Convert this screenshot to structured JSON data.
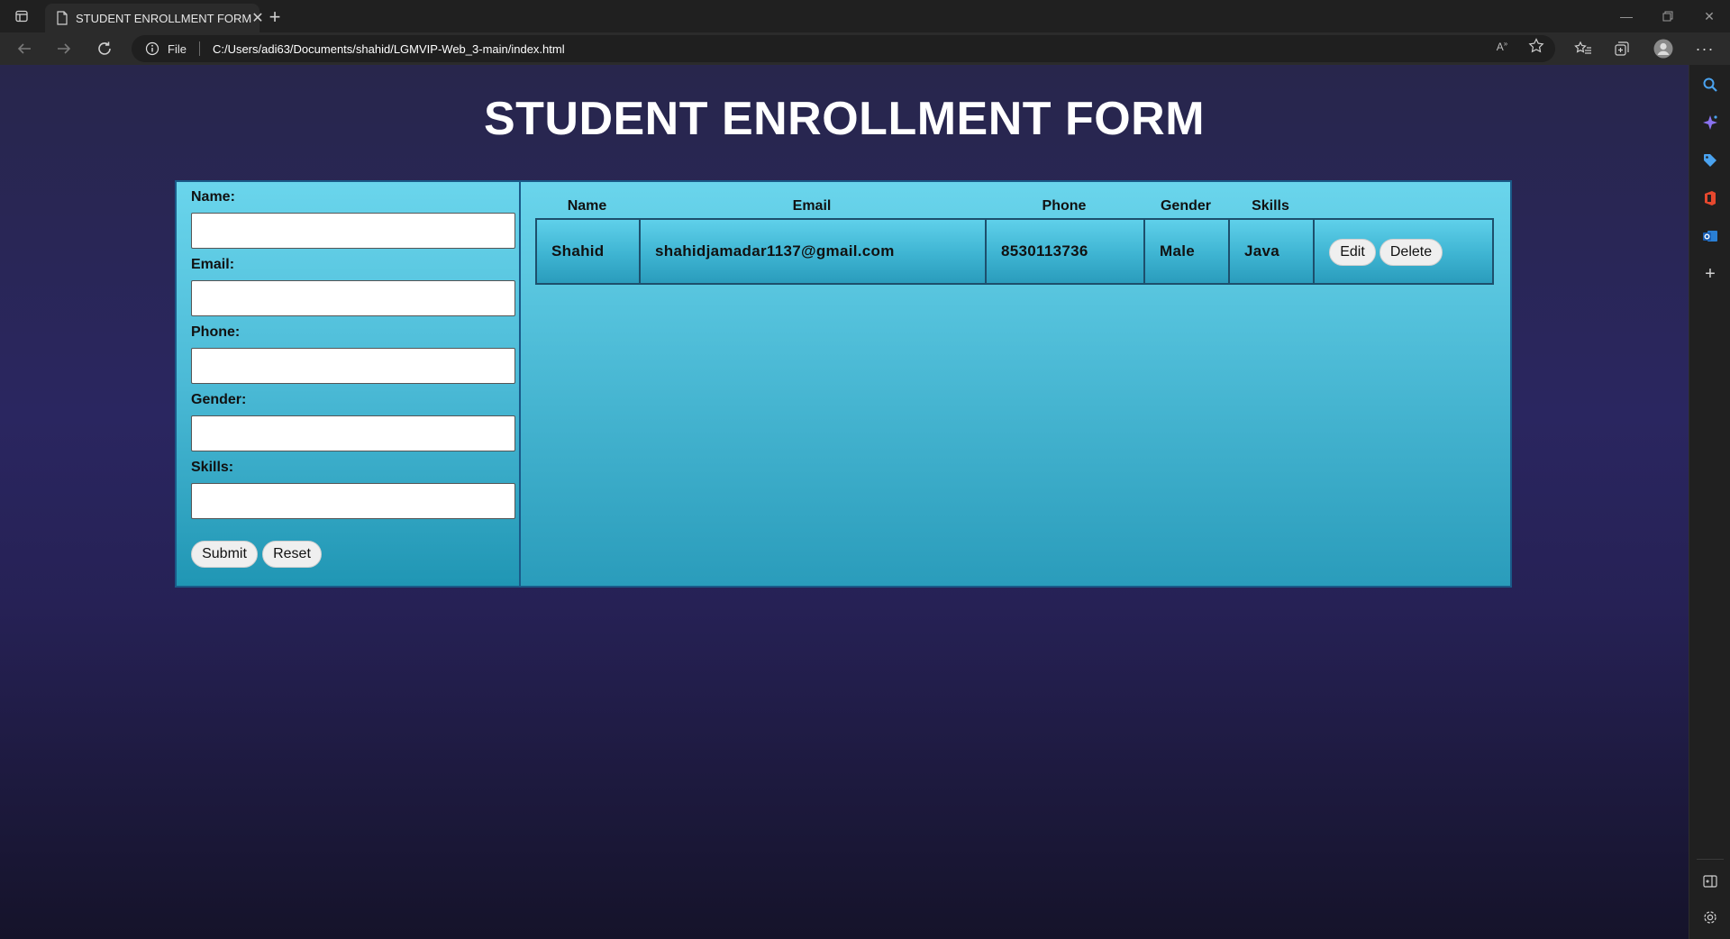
{
  "browser": {
    "tab_title": "STUDENT ENROLLMENT FORM",
    "protocol_label": "File",
    "url": "C:/Users/adi63/Documents/shahid/LGMVIP-Web_3-main/index.html"
  },
  "page": {
    "title": "STUDENT ENROLLMENT FORM"
  },
  "form": {
    "fields": [
      {
        "label": "Name:",
        "value": ""
      },
      {
        "label": "Email:",
        "value": ""
      },
      {
        "label": "Phone:",
        "value": ""
      },
      {
        "label": "Gender:",
        "value": ""
      },
      {
        "label": "Skills:",
        "value": ""
      }
    ],
    "submit_label": "Submit",
    "reset_label": "Reset"
  },
  "table": {
    "headers": [
      "Name",
      "Email",
      "Phone",
      "Gender",
      "Skills"
    ],
    "rows": [
      {
        "name": "Shahid",
        "email": "shahidjamadar1137@gmail.com",
        "phone": "8530113736",
        "gender": "Male",
        "skills": "Java",
        "edit_label": "Edit",
        "delete_label": "Delete"
      }
    ]
  }
}
